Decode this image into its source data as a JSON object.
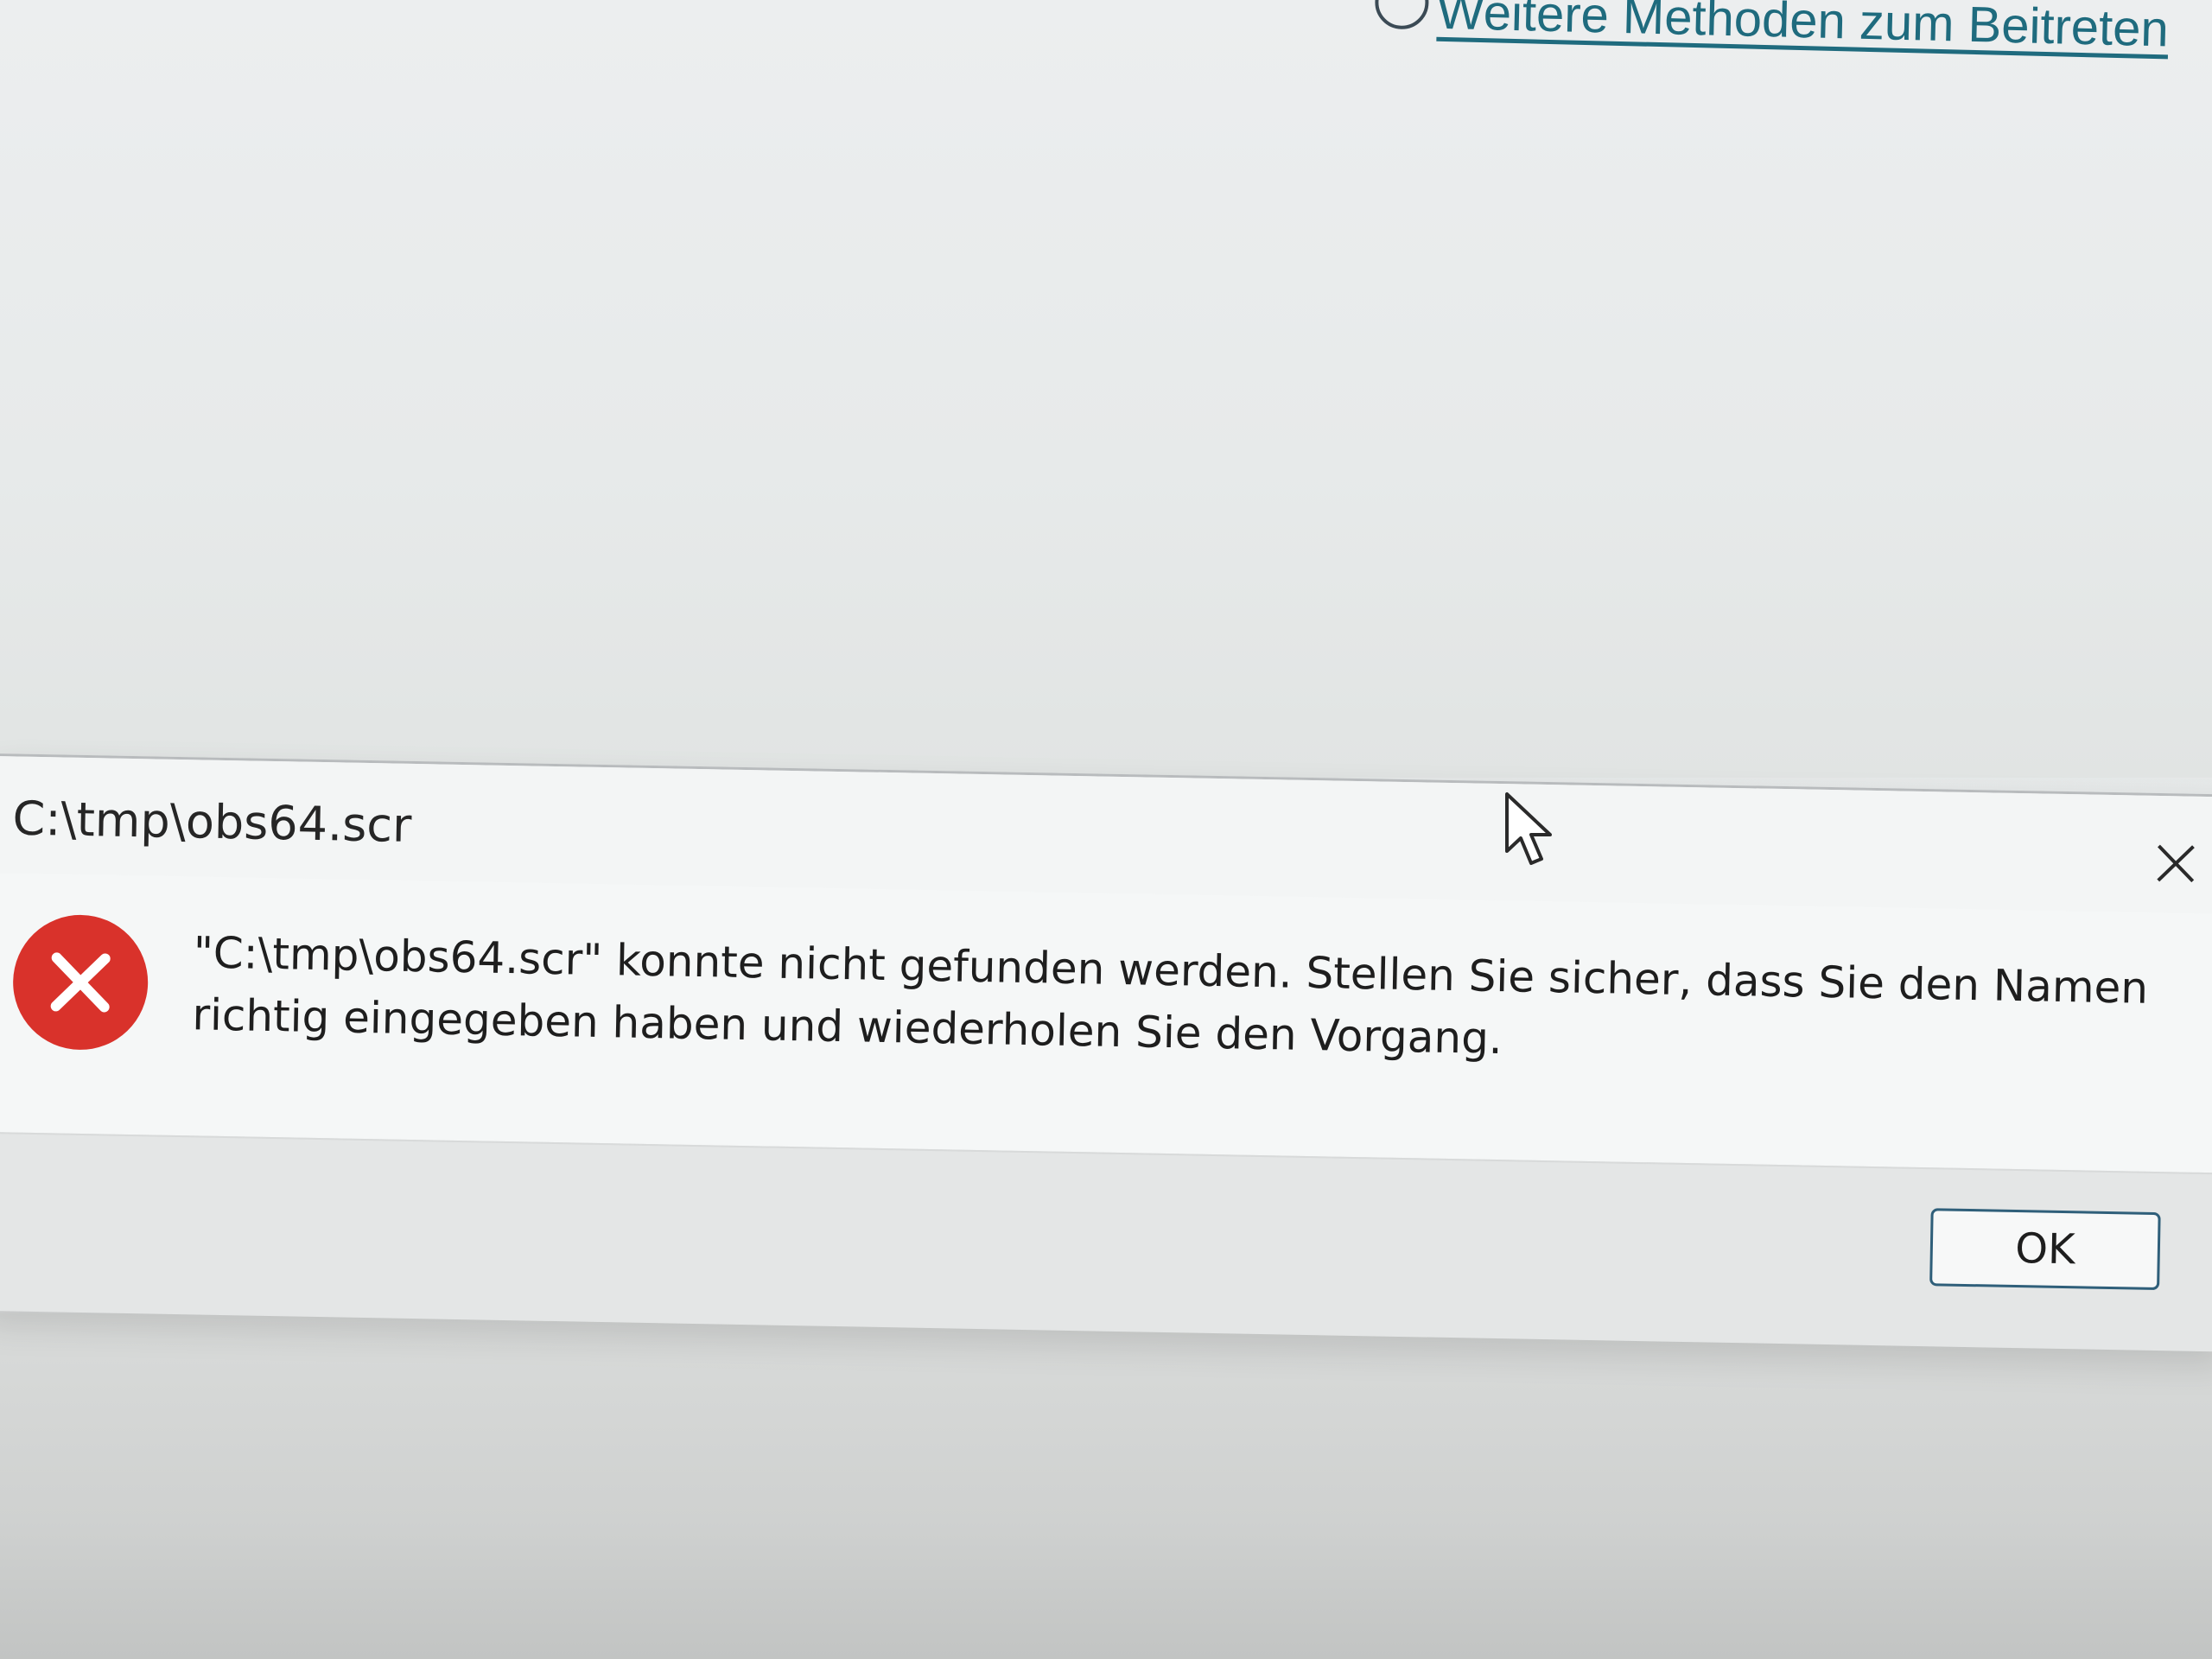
{
  "background": {
    "link_text": "Weitere Methoden zum Beitreten"
  },
  "dialog": {
    "title": "C:\\tmp\\obs64.scr",
    "icon": "error-icon",
    "message_line1": "\"C:\\tmp\\obs64.scr\" konnte nicht gefunden werden. Stellen Sie sicher, dass Sie den Namen",
    "message_line2": "richtig eingegeben haben und wiederholen Sie den Vorgang.",
    "ok_label": "OK",
    "close_icon": "close-icon"
  },
  "colors": {
    "error_red": "#d9322b",
    "button_border": "#2f5f7a",
    "link": "#1f6b7e"
  }
}
